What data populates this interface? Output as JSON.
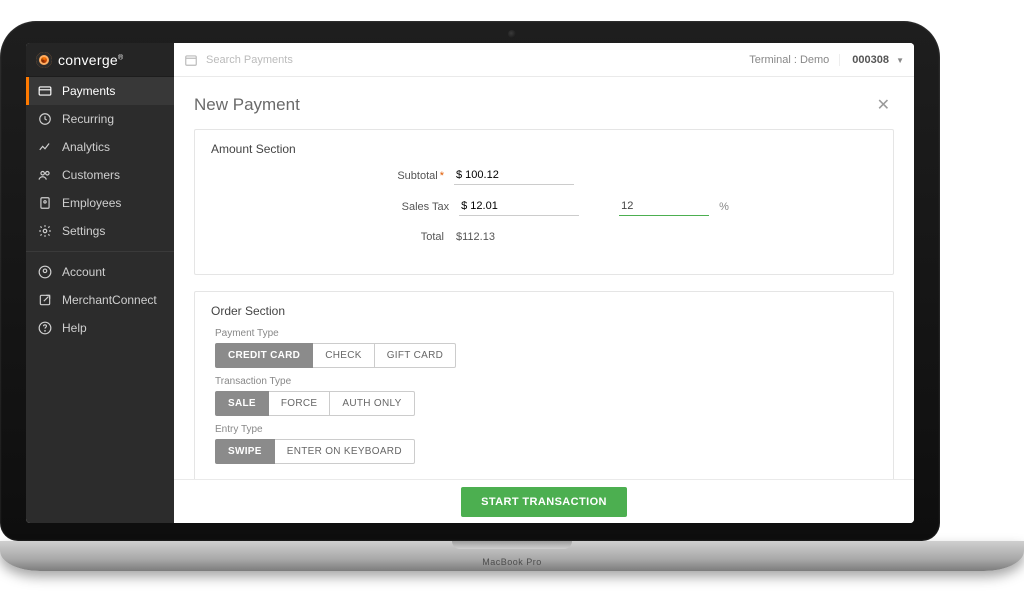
{
  "brand": {
    "name": "converge"
  },
  "sidebar": {
    "items": [
      {
        "label": "Payments"
      },
      {
        "label": "Recurring"
      },
      {
        "label": "Analytics"
      },
      {
        "label": "Customers"
      },
      {
        "label": "Employees"
      },
      {
        "label": "Settings"
      }
    ],
    "items2": [
      {
        "label": "Account"
      },
      {
        "label": "MerchantConnect"
      },
      {
        "label": "Help"
      }
    ]
  },
  "topbar": {
    "search_placeholder": "Search Payments",
    "terminal_label": "Terminal : Demo",
    "terminal_id": "000308"
  },
  "page": {
    "title": "New Payment"
  },
  "amount_section": {
    "heading": "Amount Section",
    "subtotal_label": "Subtotal",
    "subtotal_value": "$ 100.12",
    "salestax_label": "Sales Tax",
    "salestax_value": "$ 12.01",
    "salestax_pct": "12",
    "pct_symbol": "%",
    "total_label": "Total",
    "total_value": "$112.13"
  },
  "order_section": {
    "heading": "Order Section",
    "payment_type_label": "Payment Type",
    "payment_types": [
      "CREDIT CARD",
      "CHECK",
      "GIFT CARD"
    ],
    "transaction_type_label": "Transaction Type",
    "transaction_types": [
      "SALE",
      "FORCE",
      "AUTH ONLY"
    ],
    "entry_type_label": "Entry Type",
    "entry_types": [
      "SWIPE",
      "ENTER ON KEYBOARD"
    ]
  },
  "footer": {
    "start_label": "START TRANSACTION"
  },
  "device_label": "MacBook Pro"
}
